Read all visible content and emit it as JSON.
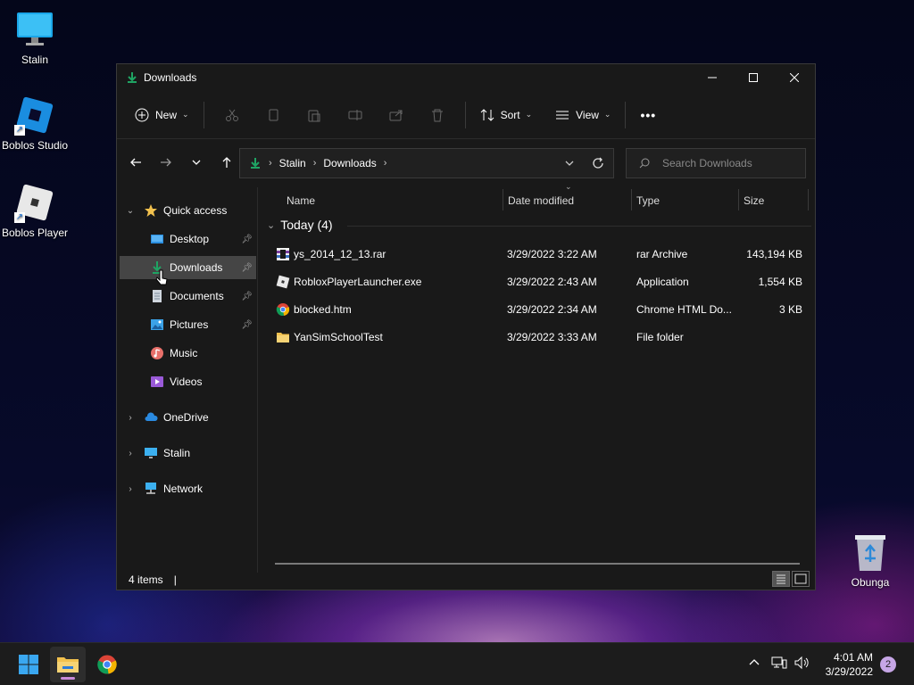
{
  "desktop": {
    "icons": [
      {
        "label": "Stalin"
      },
      {
        "label": "Boblos Studio"
      },
      {
        "label": "Boblos Player"
      },
      {
        "label": "Obunga"
      }
    ]
  },
  "window": {
    "title": "Downloads",
    "toolbar": {
      "new_label": "New",
      "sort_label": "Sort",
      "view_label": "View",
      "more_label": "•••"
    },
    "address": {
      "crumbs": [
        "Stalin",
        "Downloads"
      ]
    },
    "search": {
      "placeholder": "Search Downloads"
    },
    "nav": {
      "quick_access": "Quick access",
      "items": [
        {
          "label": "Desktop",
          "pinned": true
        },
        {
          "label": "Downloads",
          "pinned": true,
          "selected": true
        },
        {
          "label": "Documents",
          "pinned": true
        },
        {
          "label": "Pictures",
          "pinned": true
        },
        {
          "label": "Music"
        },
        {
          "label": "Videos"
        }
      ],
      "onedrive": "OneDrive",
      "thispc": "Stalin",
      "network": "Network"
    },
    "columns": {
      "name": "Name",
      "date": "Date modified",
      "type": "Type",
      "size": "Size"
    },
    "group": {
      "label": "Today (4)"
    },
    "files": [
      {
        "name": "ys_2014_12_13.rar",
        "date": "3/29/2022 3:22 AM",
        "type": "rar Archive",
        "size": "143,194 KB",
        "icon": "rar-icon"
      },
      {
        "name": "RobloxPlayerLauncher.exe",
        "date": "3/29/2022 2:43 AM",
        "type": "Application",
        "size": "1,554 KB",
        "icon": "exe-icon"
      },
      {
        "name": "blocked.htm",
        "date": "3/29/2022 2:34 AM",
        "type": "Chrome HTML Do...",
        "size": "3 KB",
        "icon": "chrome-icon"
      },
      {
        "name": "YanSimSchoolTest",
        "date": "3/29/2022 3:33 AM",
        "type": "File folder",
        "size": "",
        "icon": "folder-icon"
      }
    ],
    "status": {
      "count": "4 items",
      "sep": "|"
    }
  },
  "taskbar": {
    "time": "4:01 AM",
    "date": "3/29/2022",
    "notifications": "2"
  },
  "colors": {
    "accent": "#1fa463",
    "folder": "#f2c14e",
    "selected": "#454545"
  }
}
